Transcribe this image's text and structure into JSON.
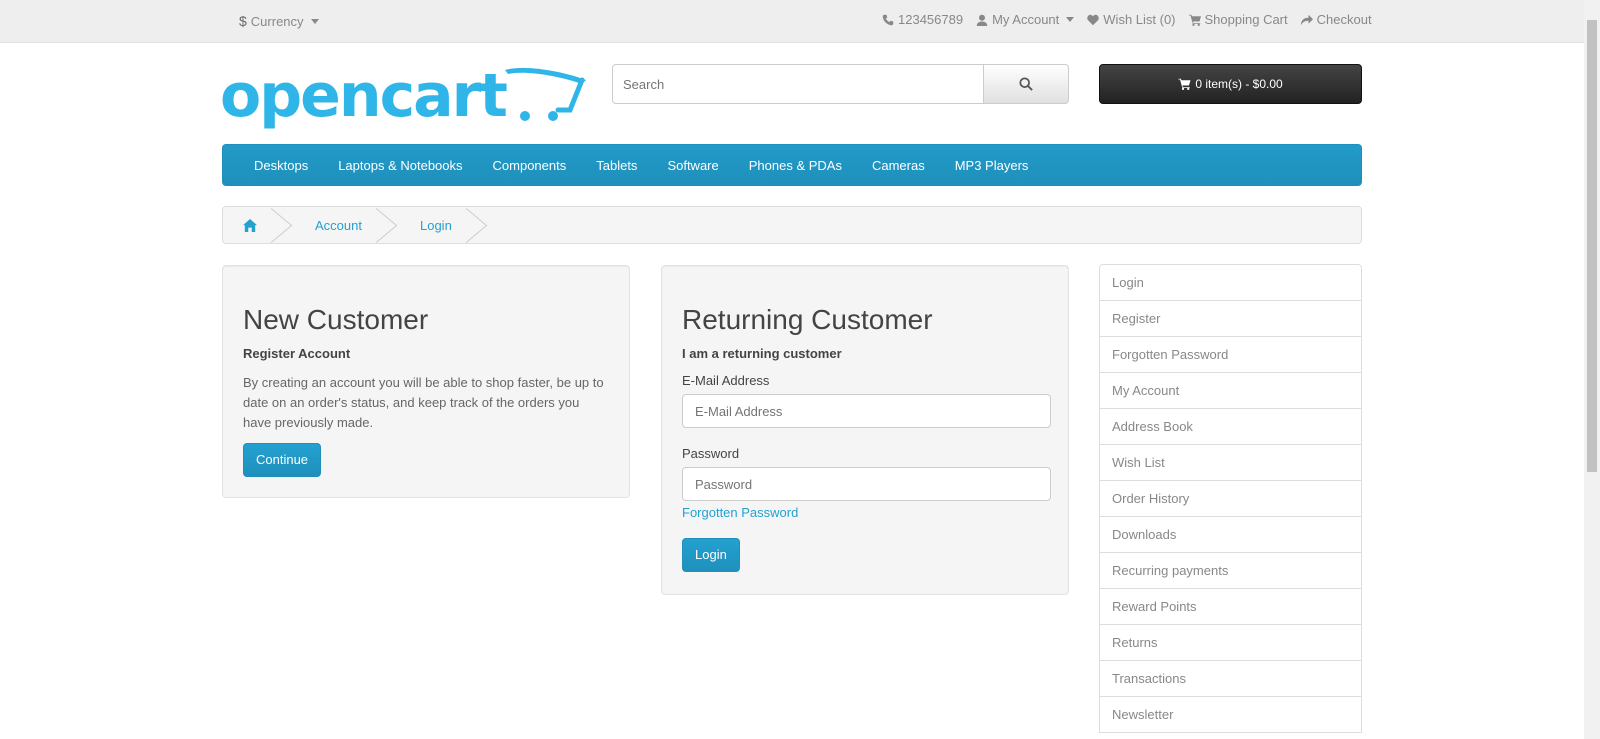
{
  "topbar": {
    "currency_symbol": "$",
    "currency_label": "Currency",
    "phone": "123456789",
    "my_account": "My Account",
    "wish_list": "Wish List (0)",
    "shopping_cart": "Shopping Cart",
    "checkout": "Checkout"
  },
  "header": {
    "logo_text": "opencart",
    "search_placeholder": "Search",
    "cart_label": "0 item(s) - $0.00"
  },
  "menu": {
    "items": [
      "Desktops",
      "Laptops & Notebooks",
      "Components",
      "Tablets",
      "Software",
      "Phones & PDAs",
      "Cameras",
      "MP3 Players"
    ]
  },
  "breadcrumb": {
    "items": [
      "Account",
      "Login"
    ]
  },
  "new_customer": {
    "title": "New Customer",
    "subtitle": "Register Account",
    "description": "By creating an account you will be able to shop faster, be up to date on an order's status, and keep track of the orders you have previously made.",
    "button": "Continue"
  },
  "returning_customer": {
    "title": "Returning Customer",
    "subtitle": "I am a returning customer",
    "email_label": "E-Mail Address",
    "email_placeholder": "E-Mail Address",
    "password_label": "Password",
    "password_placeholder": "Password",
    "forgotten_link": "Forgotten Password",
    "button": "Login"
  },
  "sidebar": {
    "items": [
      "Login",
      "Register",
      "Forgotten Password",
      "My Account",
      "Address Book",
      "Wish List",
      "Order History",
      "Downloads",
      "Recurring payments",
      "Reward Points",
      "Returns",
      "Transactions",
      "Newsletter"
    ]
  },
  "colors": {
    "accent": "#229ac8",
    "link": "#23a1d1",
    "logo": "#2fb5e8"
  }
}
